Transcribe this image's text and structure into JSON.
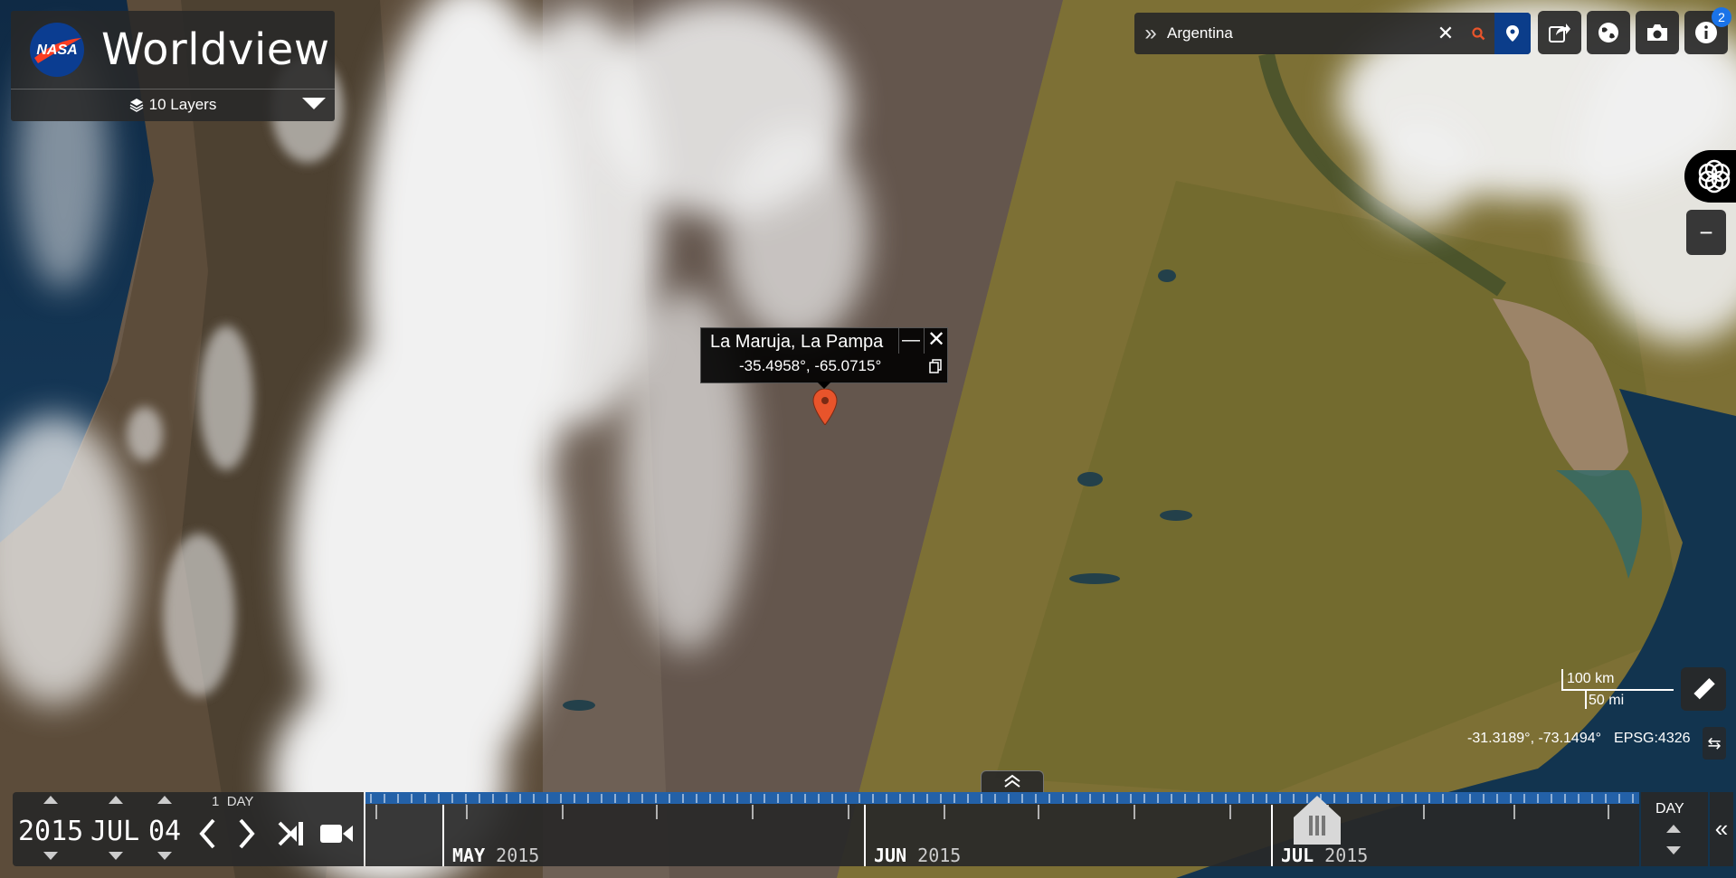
{
  "app": {
    "title": "Worldview",
    "logo": "NASA"
  },
  "layers": {
    "label": "10 Layers"
  },
  "search": {
    "query": "Argentina",
    "clear_label": "✕"
  },
  "toolbar": {
    "info_badge": "2"
  },
  "popup": {
    "place": "La Maruja, La Pampa",
    "coords": "-35.4958°, -65.0715°",
    "minimize_label": "—",
    "close_label": "✕"
  },
  "scale": {
    "km": "100 km",
    "mi": "50 mi"
  },
  "cursor": {
    "coords": "-31.3189°, -73.1494°",
    "projection": "EPSG:4326"
  },
  "date": {
    "year": "2015",
    "month": "JUL",
    "day": "04"
  },
  "interval": {
    "count": "1",
    "unit": "DAY"
  },
  "timeline": {
    "zoom_level": "DAY",
    "months": [
      {
        "month": "MAY",
        "year": "2015"
      },
      {
        "month": "JUN",
        "year": "2015"
      },
      {
        "month": "JUL",
        "year": "2015"
      }
    ]
  },
  "colors": {
    "accent": "#0b3d8a",
    "timeline_strip": "#2361a8",
    "marker": "#e8542b",
    "panel": "#282828"
  },
  "icons": [
    "layers-icon",
    "search-icon",
    "location-pin-icon",
    "share-icon",
    "projection-globe-icon",
    "camera-icon",
    "info-icon",
    "zoom-in-icon",
    "zoom-out-icon",
    "ruler-icon",
    "swap-icon",
    "video-icon",
    "chevron-left-icon",
    "chevron-right-icon",
    "skip-end-icon",
    "collapse-icon"
  ]
}
